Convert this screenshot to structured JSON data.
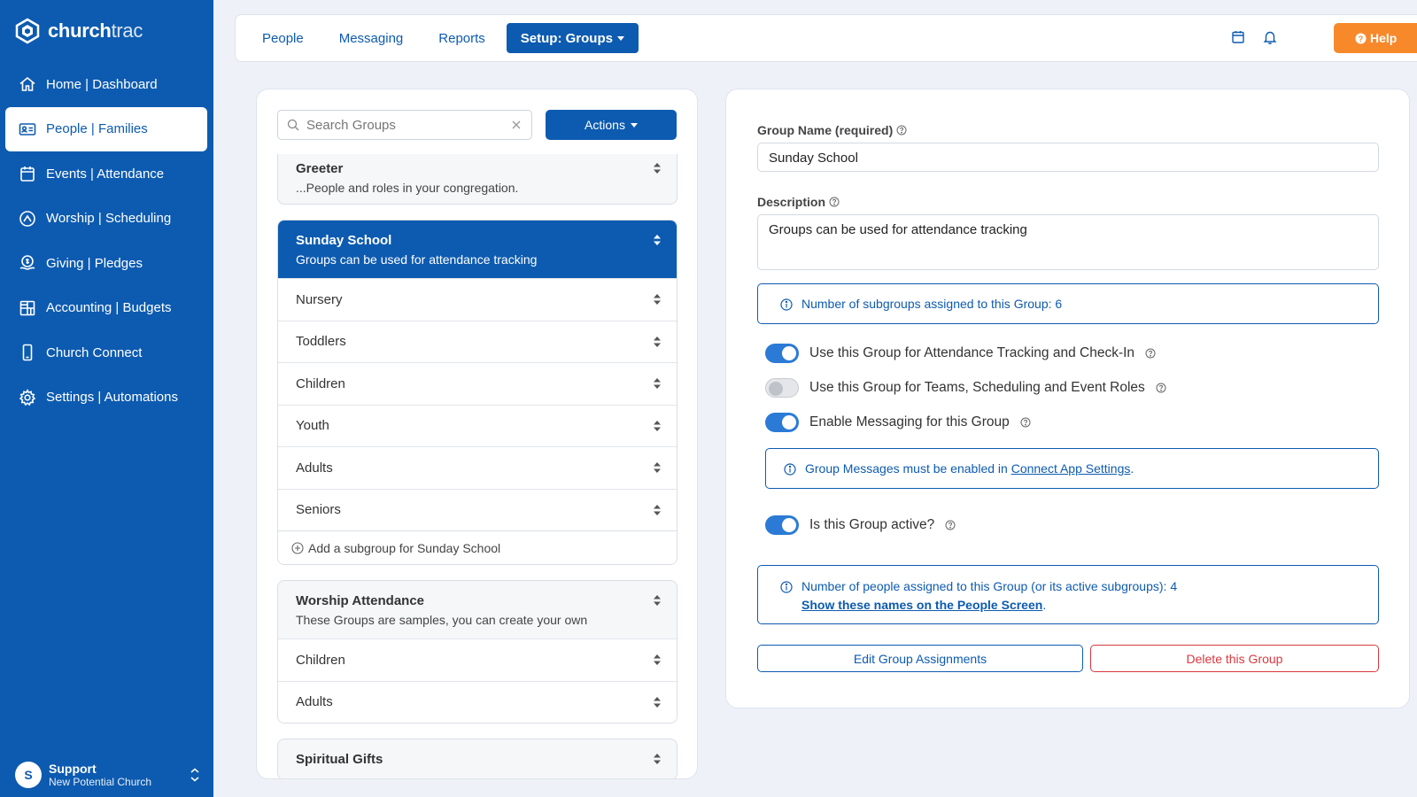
{
  "brand": {
    "name_bold": "church",
    "name_light": "trac"
  },
  "sidebar": {
    "items": [
      {
        "label": "Home | Dashboard",
        "icon": "home-icon"
      },
      {
        "label": "People | Families",
        "icon": "id-card-icon",
        "active": true
      },
      {
        "label": "Events | Attendance",
        "icon": "calendar-icon"
      },
      {
        "label": "Worship | Scheduling",
        "icon": "worship-icon"
      },
      {
        "label": "Giving | Pledges",
        "icon": "giving-icon"
      },
      {
        "label": "Accounting | Budgets",
        "icon": "grid-icon"
      },
      {
        "label": "Church Connect",
        "icon": "phone-icon"
      },
      {
        "label": "Settings | Automations",
        "icon": "gear-icon"
      }
    ],
    "user": {
      "initial": "S",
      "name": "Support",
      "org": "New Potential Church"
    }
  },
  "topbar": {
    "tabs": [
      "People",
      "Messaging",
      "Reports",
      "Setup: Groups"
    ],
    "help_label": "Help"
  },
  "groups_panel": {
    "search_placeholder": "Search Groups",
    "actions_label": "Actions",
    "groups": [
      {
        "title": "Greeter",
        "description": "...People and roles in your congregation.",
        "subgroups": []
      },
      {
        "title": "Sunday School",
        "description": "Groups can be used for attendance tracking",
        "selected": true,
        "subgroups": [
          "Nursery",
          "Toddlers",
          "Children",
          "Youth",
          "Adults",
          "Seniors"
        ],
        "add_label": "Add a subgroup for Sunday School"
      },
      {
        "title": "Worship Attendance",
        "description": "These Groups are samples, you can create your own",
        "subgroups": [
          "Children",
          "Adults"
        ]
      },
      {
        "title": "Spiritual Gifts",
        "description": "",
        "subgroups": []
      }
    ]
  },
  "detail": {
    "name_label": "Group Name (required)",
    "name_value": "Sunday School",
    "desc_label": "Description",
    "desc_value": "Groups can be used for attendance tracking",
    "subgroups_info": "Number of subgroups assigned to this Group: 6",
    "toggles": {
      "attendance": {
        "label": "Use this Group for Attendance Tracking and Check-In",
        "on": true
      },
      "teams": {
        "label": "Use this Group for Teams, Scheduling and Event Roles",
        "on": false
      },
      "messaging": {
        "label": "Enable Messaging for this Group",
        "on": true
      },
      "active": {
        "label": "Is this Group active?",
        "on": true
      }
    },
    "messages_info_prefix": "Group Messages must be enabled in",
    "messages_info_link": "Connect App Settings",
    "messages_info_suffix": ".",
    "people_info": "Number of people assigned to this Group (or its active subgroups): 4",
    "people_link": "Show these names on the People Screen",
    "people_link_suffix": ".",
    "edit_button": "Edit Group Assignments",
    "delete_button": "Delete this Group"
  },
  "colors": {
    "primary": "#0d5bb0",
    "help": "#f7892b",
    "danger": "#d9383f",
    "toggle_on": "#2b7bd6"
  }
}
